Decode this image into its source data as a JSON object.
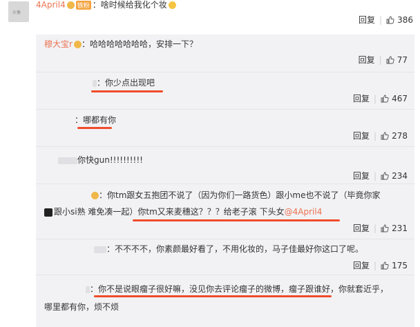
{
  "top_comment": {
    "avatar_text": "头像",
    "username": "4April4",
    "badge": "铁粉",
    "text": "：啥时候给我化个妆",
    "actions": {
      "reply": "回复",
      "likes": "386"
    }
  },
  "replies": [
    {
      "username": "穆大宝r",
      "text": "：哈哈哈哈哈哈哈，安排一下？",
      "reply": "回复",
      "likes": "77"
    },
    {
      "text": "：你少点出现吧",
      "reply": "回复",
      "likes": "467"
    },
    {
      "text": "：哪都有你",
      "reply": "回复",
      "likes": "278"
    },
    {
      "text": "你快gun!!!!!!!!!!",
      "reply": "回复",
      "likes": "234"
    },
    {
      "text_line1": "：你tm跟女五抱团不说了（因为你们一路货色）跟小me也不说了（毕竟你家",
      "text_line2": "跟小si熟 难免凑一起）你tm又来麦穗这？？？给老子滚 下头女",
      "mention": "@4April4",
      "reply": "回复",
      "likes": "231"
    },
    {
      "text": "：不不不不，你素颜最好看了，不用化妆的，马子佳最好你这口了呢。",
      "reply": "回复",
      "likes": "175"
    },
    {
      "text_line1": "：你不是说眼瘤子很好嘛，没见你去评论瘤子的微博，瘤子跟谁好，你就套近乎，",
      "text_line2": "哪里都有你，烦不烦"
    }
  ]
}
